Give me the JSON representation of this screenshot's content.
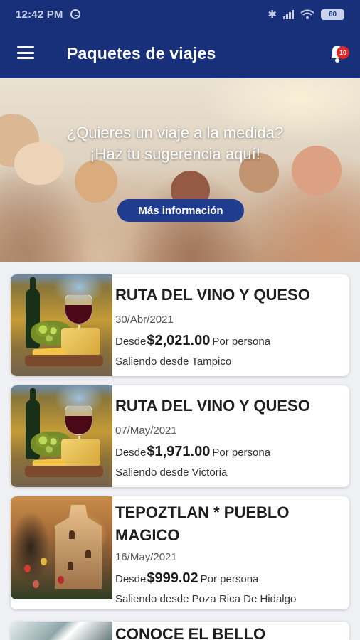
{
  "status_bar": {
    "time": "12:42 PM",
    "battery": "60"
  },
  "app_bar": {
    "title": "Paquetes de viajes",
    "notification_count": "10"
  },
  "hero": {
    "line1": "¿Quieres un viaje a la medida?",
    "line2": "¡Haz tu sugerencia aquí!",
    "button_label": "Más información"
  },
  "packages": [
    {
      "title": "RUTA DEL VINO Y QUESO",
      "date": "30/Abr/2021",
      "prefix": "Desde",
      "price": "$2,021.00",
      "per_person": "Por persona",
      "origin": "Saliendo desde Tampico",
      "image_icon": "wine-cheese-photo"
    },
    {
      "title": "RUTA DEL VINO Y QUESO",
      "date": "07/May/2021",
      "prefix": "Desde",
      "price": "$1,971.00",
      "per_person": "Por persona",
      "origin": "Saliendo desde Victoria",
      "image_icon": "wine-cheese-photo"
    },
    {
      "title": "TEPOZTLAN * PUEBLO MAGICO",
      "date": "16/May/2021",
      "prefix": "Desde",
      "price": "$999.02",
      "per_person": "Por persona",
      "origin": "Saliendo desde Poza Rica De Hidalgo",
      "image_icon": "tepoztlan-church-photo"
    },
    {
      "title": "CONOCE EL BELLO",
      "image_icon": "beach-photo"
    }
  ],
  "colors": {
    "primary": "#173079",
    "button": "#203c8e",
    "badge": "#e32626"
  }
}
